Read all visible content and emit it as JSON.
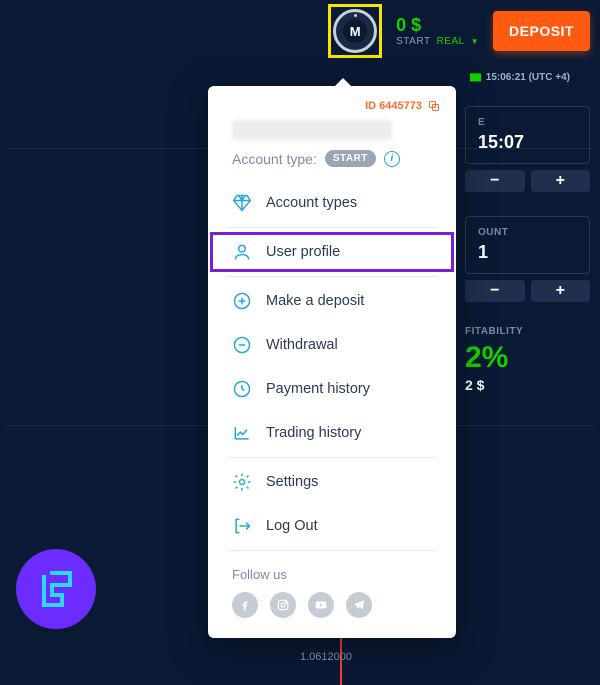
{
  "topbar": {
    "avatar_letter": "M",
    "balance": "0 $",
    "status_start": "START",
    "status_real": "REAL",
    "deposit_label": "DEPOSIT"
  },
  "server_time": "15:06:21 (UTC +4)",
  "right_panel": {
    "time_label_suffix": "E",
    "time_value": "15:07",
    "amount_label_suffix": "OUNT",
    "amount_value_suffix": "1",
    "profit_label_suffix": "FITABILITY",
    "profit_pct_suffix": "2%",
    "profit_amount_suffix": "2 $"
  },
  "dropdown": {
    "id_text": "ID 6445773",
    "account_type_label": "Account type:",
    "account_badge": "START",
    "items": {
      "account_types": "Account types",
      "user_profile": "User profile",
      "make_deposit": "Make a deposit",
      "withdrawal": "Withdrawal",
      "payment_history": "Payment history",
      "trading_history": "Trading history",
      "settings": "Settings",
      "log_out": "Log Out"
    },
    "follow_label": "Follow us"
  },
  "chart": {
    "x_label": "1.0612000"
  }
}
